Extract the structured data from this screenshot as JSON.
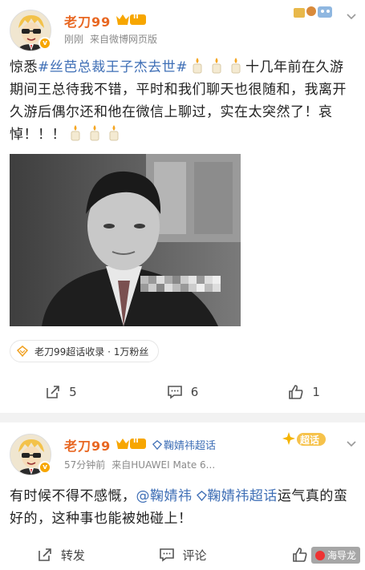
{
  "posts": [
    {
      "username": "老刀99",
      "level_badge": "II",
      "time": "刚刚",
      "source": "来自微博网页版",
      "text_parts": [
        {
          "type": "plain",
          "text": "惊悉"
        },
        {
          "type": "tag",
          "text": "#丝芭总裁王子杰去世#"
        },
        {
          "type": "candles",
          "count": 3
        },
        {
          "type": "plain",
          "text": "十几年前在久游期间王总待我不错，平时和我们聊天也很随和，我离开久游后偶尔还和他在微信上聊过，实在太突然了！哀悼！！！"
        },
        {
          "type": "candles",
          "count": 3
        }
      ],
      "chip_text": "老刀99超话收录 · 1万粉丝",
      "actions": {
        "repost": "5",
        "comment": "6",
        "like": "1"
      }
    },
    {
      "username": "老刀99",
      "level_badge": "II",
      "supertopic": "鞠婧祎超话",
      "time": "57分钟前",
      "source": "来自HUAWEI Mate 6...",
      "corner_badge": "超话",
      "text_before": "有时候不得不感慨，",
      "mention": "@鞠婧祎",
      "supertopic_inline": "鞠婧祎超话",
      "text_after": "运气真的蛮好的，这种事也能被她碰上！",
      "actions": {
        "repost": "转发",
        "comment": "评论",
        "like": ""
      }
    }
  ],
  "watermark": "海导龙",
  "colors": {
    "username": "#e86722",
    "link": "#3f6fb6",
    "meta": "#8a8a8a"
  }
}
